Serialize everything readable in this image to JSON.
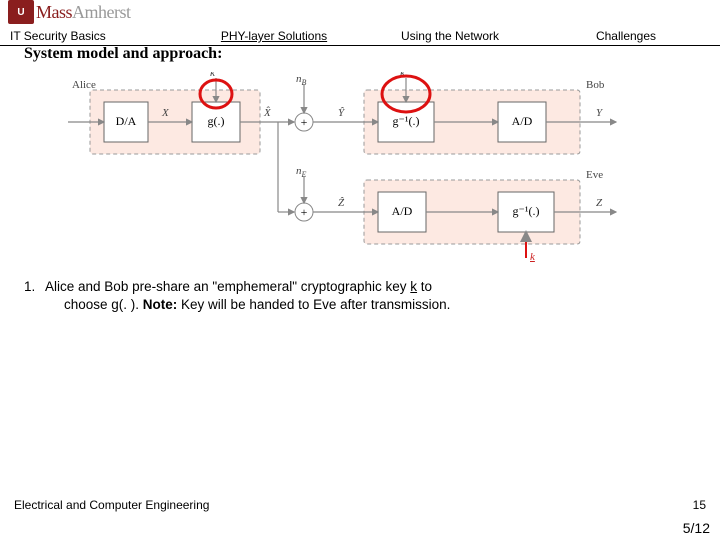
{
  "logo": {
    "mark": "U",
    "text1": "Mass",
    "text2": "Amherst"
  },
  "tabs": {
    "t1": "IT Security Basics",
    "t2": "PHY-layer Solutions",
    "t3": "Using the Network",
    "t4": "Challenges"
  },
  "section_title": "System model and approach:",
  "diagram": {
    "alice": "Alice",
    "bob": "Bob",
    "eve": "Eve",
    "da": "D/A",
    "g": "g(.)",
    "ginv": "g⁻¹(.)",
    "ad": "A/D",
    "k": "k",
    "x": "X",
    "xhat": "X̂",
    "y": "Y",
    "yhat": "Ŷ",
    "z": "Z",
    "nB": "n_B",
    "nE": "n_E",
    "klow": "k"
  },
  "bullet": {
    "num": "1.",
    "line1a": "Alice and Bob pre-share an \"emphemeral\" cryptographic key ",
    "kvar": "k",
    "line1b": " to",
    "line2a": "choose g(. ).  ",
    "noteLabel": "Note:",
    "line2b": "  Key will be handed to Eve after transmission."
  },
  "footer": {
    "dept": "Electrical and Computer Engineering",
    "page": "15",
    "date": "5/12"
  }
}
